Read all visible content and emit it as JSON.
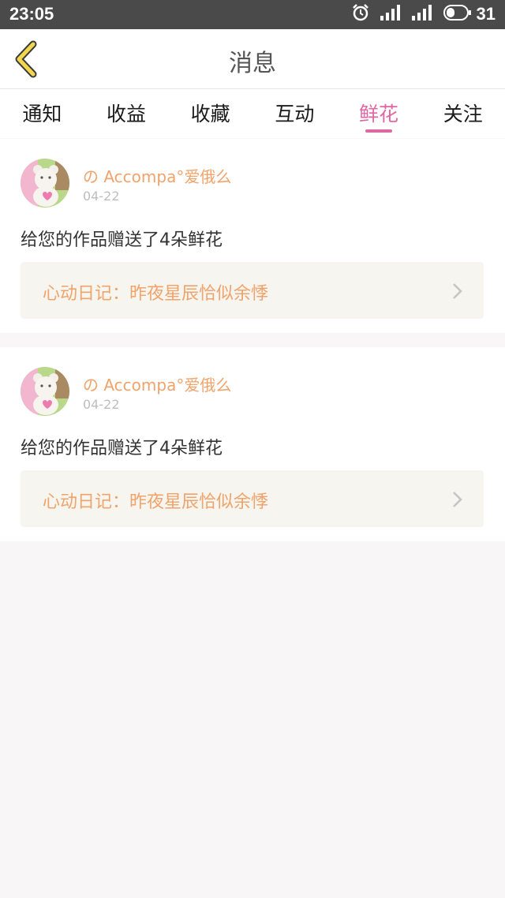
{
  "status_bar": {
    "time": "23:05",
    "battery": "31",
    "icons": [
      "alarm-icon",
      "signal-icon",
      "signal-icon",
      "battery-icon"
    ]
  },
  "header": {
    "title": "消息",
    "back_icon": "chevron-left-icon",
    "accent_color": "#f2d74e"
  },
  "tabs": [
    {
      "label": "通知",
      "active": false
    },
    {
      "label": "收益",
      "active": false
    },
    {
      "label": "收藏",
      "active": false
    },
    {
      "label": "互动",
      "active": false
    },
    {
      "label": "鲜花",
      "active": true
    },
    {
      "label": "关注",
      "active": false
    }
  ],
  "colors": {
    "active_tab": "#e067a4",
    "username": "#f0a36a",
    "page_background": "#f8f6f6"
  },
  "messages": [
    {
      "username": "の Accompa°爱俄么",
      "date": "04-22",
      "text": "给您的作品赠送了4朵鲜花",
      "work_title": "心动日记：昨夜星辰恰似余悸"
    },
    {
      "username": "の Accompa°爱俄么",
      "date": "04-22",
      "text": "给您的作品赠送了4朵鲜花",
      "work_title": "心动日记：昨夜星辰恰似余悸"
    }
  ]
}
